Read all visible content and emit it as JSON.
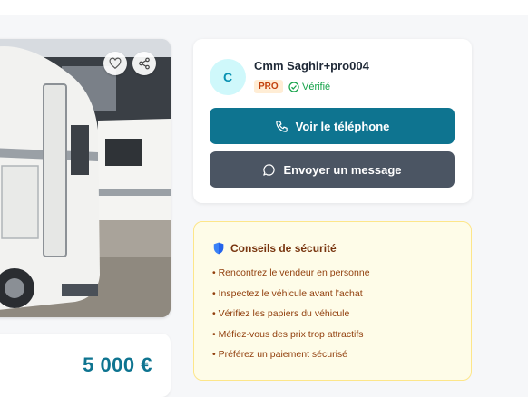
{
  "seller": {
    "avatar_initial": "C",
    "name": "Cmm Saghir+pro004",
    "badge": "PRO",
    "verified_label": "Vérifié"
  },
  "actions": {
    "phone_label": "Voir le téléphone",
    "message_label": "Envoyer un message"
  },
  "listing": {
    "price": "5 000 €",
    "photo_icons": [
      "heart-icon",
      "share-icon"
    ]
  },
  "safety": {
    "title": "Conseils de sécurité",
    "tips": [
      "Rencontrez le vendeur en personne",
      "Inspectez le véhicule avant l'achat",
      "Vérifiez les papiers du véhicule",
      "Méfiez-vous des prix trop attractifs",
      "Préférez un paiement sécurisé"
    ]
  },
  "colors": {
    "primary": "#0e7490",
    "secondary": "#4b5563",
    "verified": "#16a34a",
    "warning_bg": "#fefce8"
  }
}
